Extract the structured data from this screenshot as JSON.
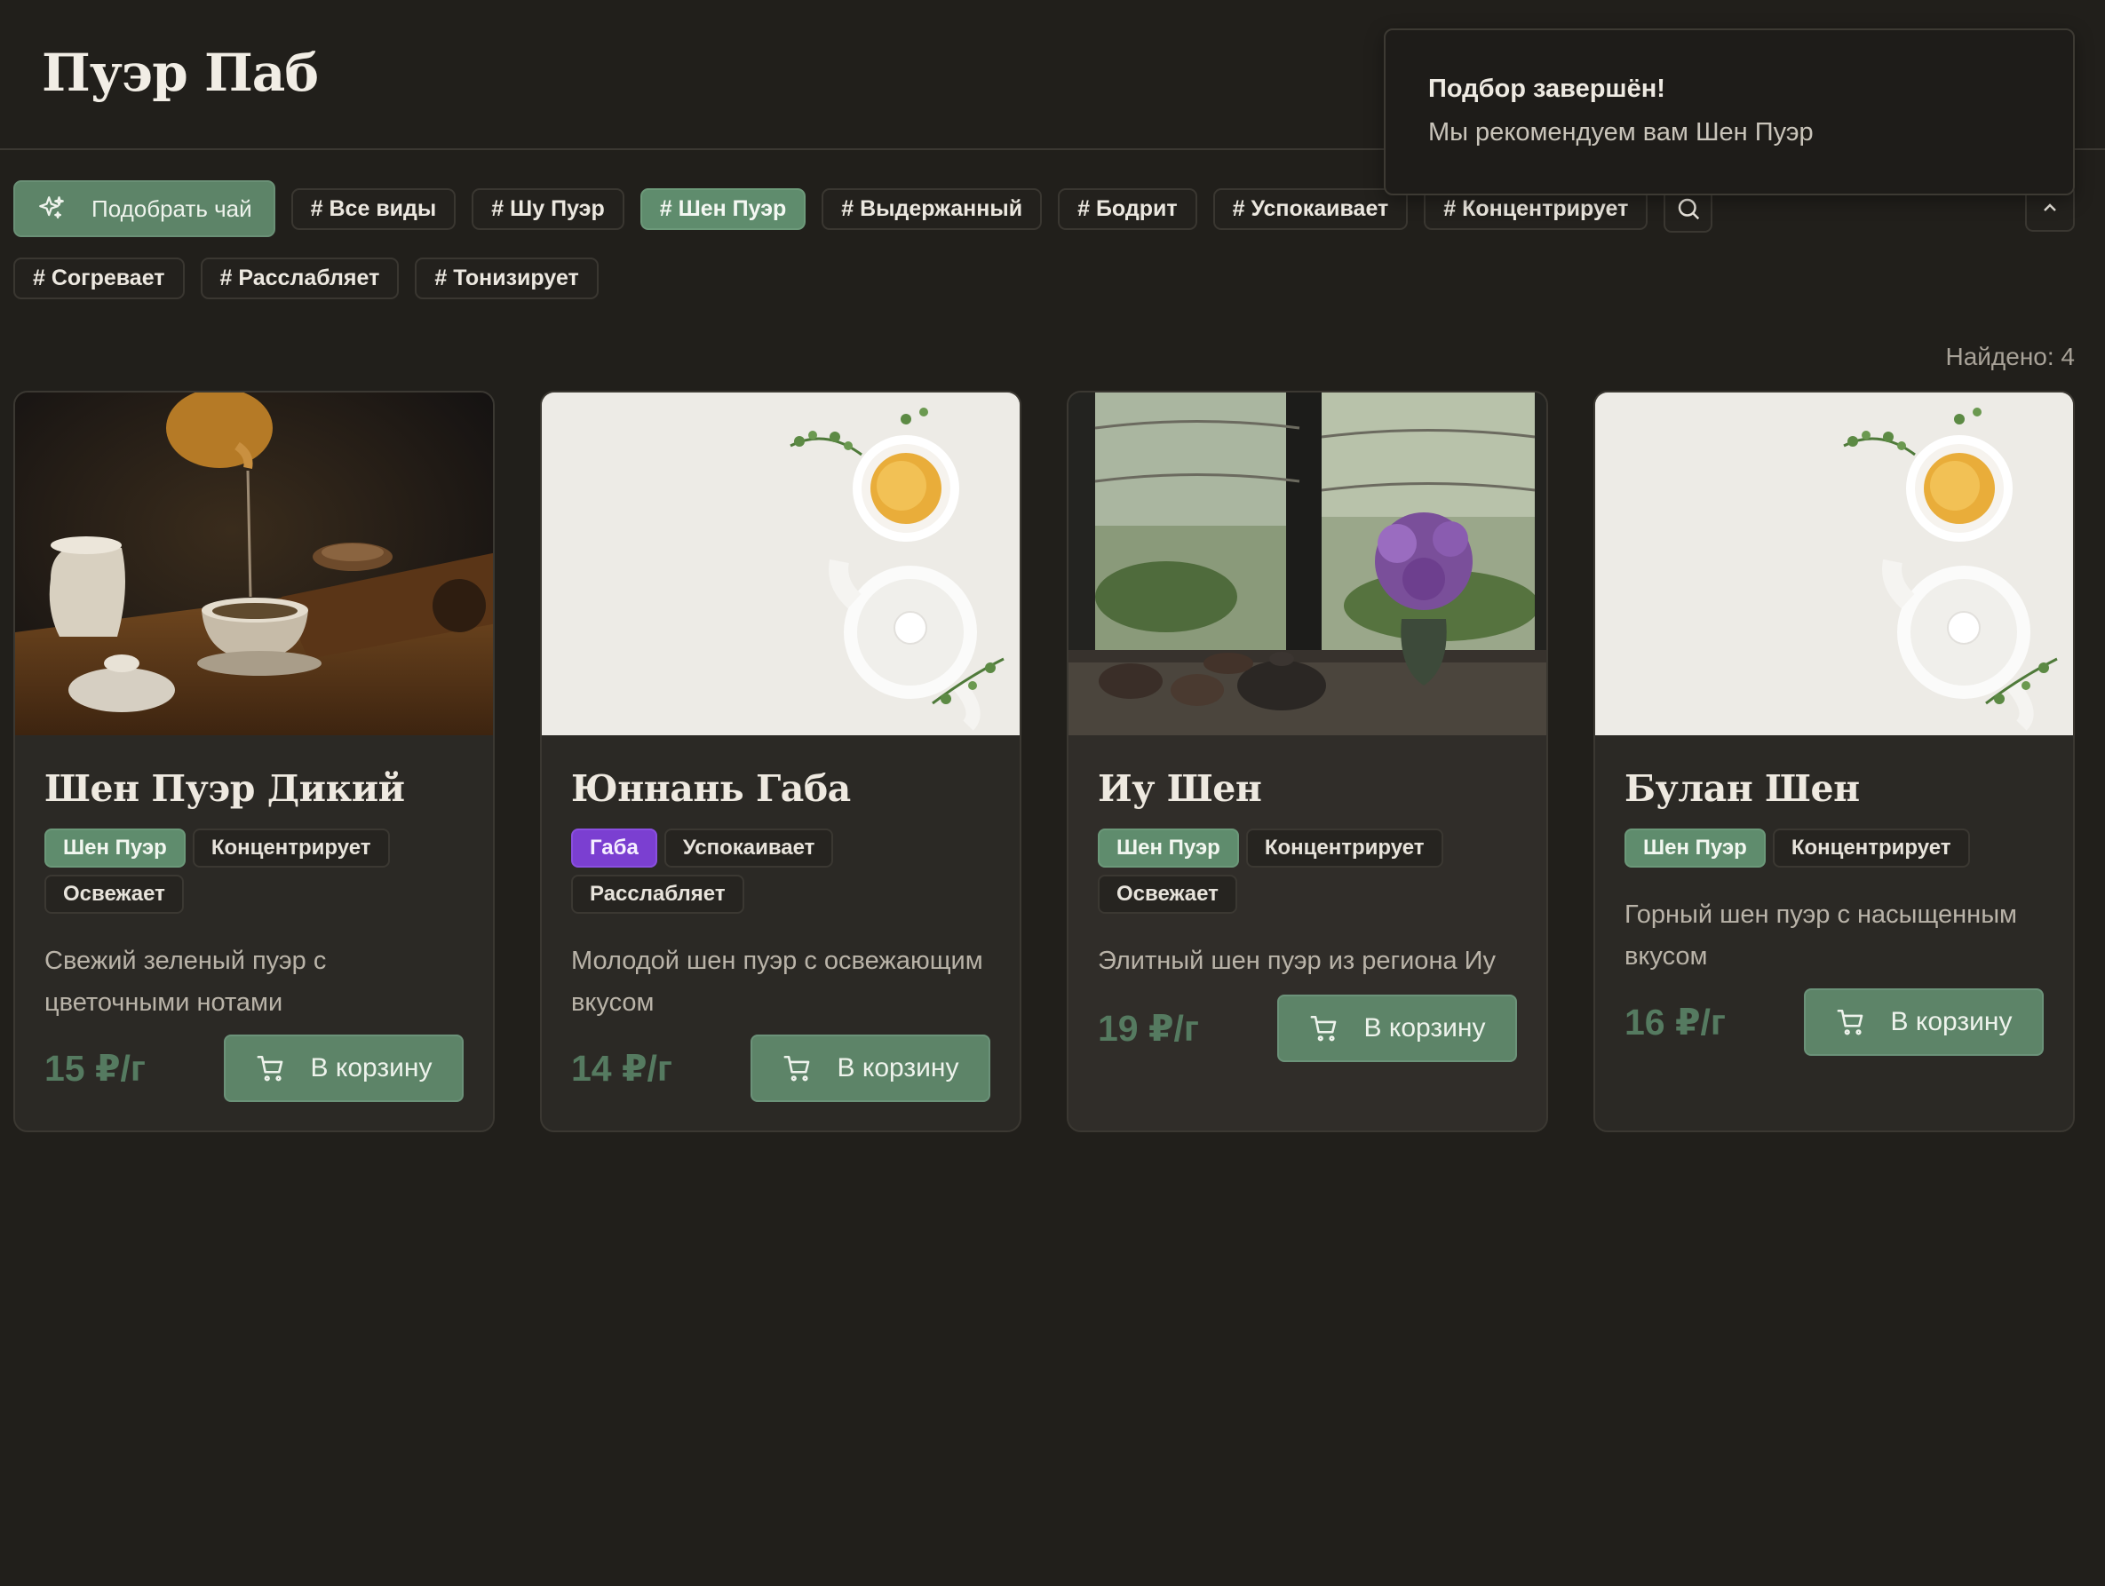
{
  "app": {
    "title": "Пуэр Паб"
  },
  "toast": {
    "title": "Подбор завершён!",
    "message": "Мы рекомендуем вам Шен Пуэр"
  },
  "filters": {
    "pick_button": "Подобрать чай",
    "chips_row1": [
      "# Все виды",
      "# Шу Пуэр",
      "# Шен Пуэр",
      "# Выдержанный",
      "# Бодрит",
      "# Успокаивает",
      "# Концентрирует"
    ],
    "chips_row2": [
      "# Согревает",
      "# Расслабляет",
      "# Тонизирует"
    ],
    "active_chip": "# Шен Пуэр",
    "search_icon": "search-icon",
    "collapse_icon": "chevron-up-icon"
  },
  "results": {
    "found_label": "Найдено: 4"
  },
  "products": [
    {
      "title": "Шен Пуэр Дикий",
      "tags": [
        {
          "label": "Шен Пуэр",
          "style": "green"
        },
        {
          "label": "Концентрирует",
          "style": "plain"
        },
        {
          "label": "Освежает",
          "style": "plain"
        }
      ],
      "description": "Свежий зеленый пуэр с цветочными нотами",
      "price": "15 ₽/г",
      "cart_label": "В корзину",
      "image": "tea-pouring-photo"
    },
    {
      "title": "Юннань Габа",
      "tags": [
        {
          "label": "Габа",
          "style": "purple"
        },
        {
          "label": "Успокаивает",
          "style": "plain"
        },
        {
          "label": "Расслабляет",
          "style": "plain"
        }
      ],
      "description": "Молодой шен пуэр с освежающим вкусом",
      "price": "14 ₽/г",
      "cart_label": "В корзину",
      "image": "white-teapot-photo"
    },
    {
      "title": "Иу Шен",
      "tags": [
        {
          "label": "Шен Пуэр",
          "style": "green"
        },
        {
          "label": "Концентрирует",
          "style": "plain"
        },
        {
          "label": "Освежает",
          "style": "plain"
        }
      ],
      "description": "Элитный шен пуэр из региона Иу",
      "price": "19 ₽/г",
      "cart_label": "В корзину",
      "image": "window-flowers-photo"
    },
    {
      "title": "Булан Шен",
      "tags": [
        {
          "label": "Шен Пуэр",
          "style": "green"
        },
        {
          "label": "Концентрирует",
          "style": "plain"
        }
      ],
      "description": "Горный шен пуэр с насыщенным вкусом",
      "price": "16 ₽/г",
      "cart_label": "В корзину",
      "image": "white-teapot-photo"
    }
  ],
  "colors": {
    "background": "#211f1b",
    "accent": "#5d8468",
    "price": "#557a60",
    "tag_purple": "#7b3fd1"
  }
}
